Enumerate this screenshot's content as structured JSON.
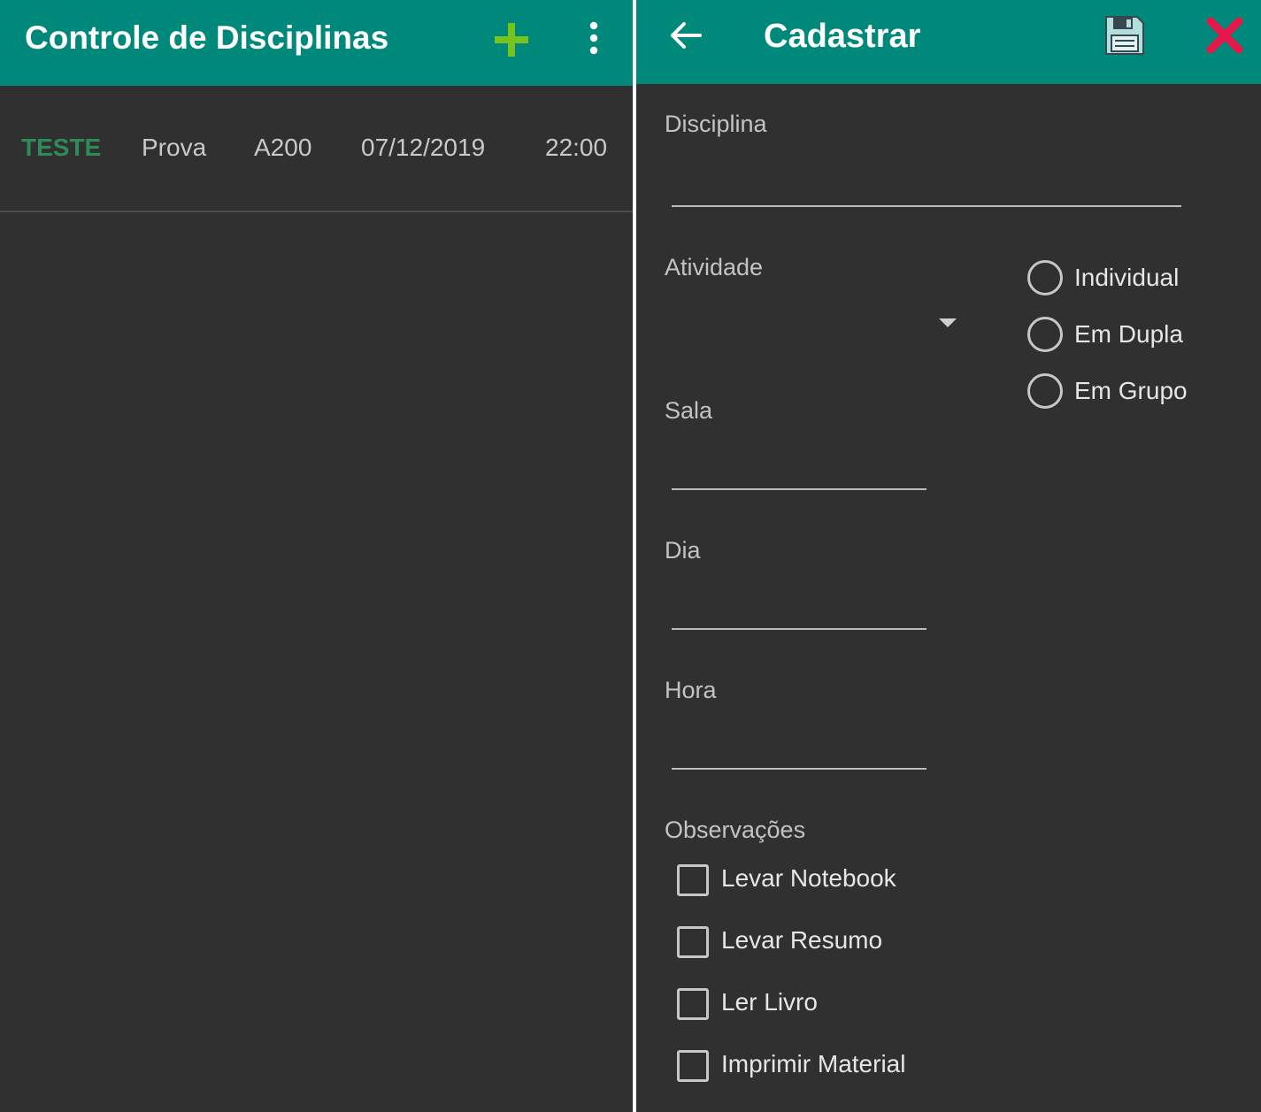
{
  "list_screen": {
    "title": "Controle de Disciplinas",
    "icons": {
      "add": "plus-icon",
      "menu": "more-vert-icon"
    },
    "rows": [
      {
        "discipline": "TESTE",
        "activity": "Prova",
        "room": "A200",
        "date": "07/12/2019",
        "time": "22:00"
      }
    ]
  },
  "form_screen": {
    "title": "Cadastrar",
    "icons": {
      "back": "arrow-back-icon",
      "save": "floppy-disk-icon",
      "close": "close-x-icon"
    },
    "fields": {
      "disciplina": {
        "label": "Disciplina",
        "value": ""
      },
      "atividade": {
        "label": "Atividade",
        "value": ""
      },
      "sala": {
        "label": "Sala",
        "value": ""
      },
      "dia": {
        "label": "Dia",
        "value": ""
      },
      "hora": {
        "label": "Hora",
        "value": ""
      }
    },
    "mode_options": [
      {
        "label": "Individual",
        "selected": false
      },
      {
        "label": "Em Dupla",
        "selected": false
      },
      {
        "label": "Em Grupo",
        "selected": false
      }
    ],
    "observations": {
      "label": "Observações",
      "items": [
        {
          "label": "Levar Notebook",
          "checked": false
        },
        {
          "label": "Levar Resumo",
          "checked": false
        },
        {
          "label": "Ler Livro",
          "checked": false
        },
        {
          "label": "Imprimir Material",
          "checked": false
        }
      ]
    }
  },
  "colors": {
    "appbar": "#00897b",
    "background": "#303030",
    "accent_add": "#76c31d",
    "close": "#e8174a",
    "discipline_text": "#2e8b57"
  }
}
